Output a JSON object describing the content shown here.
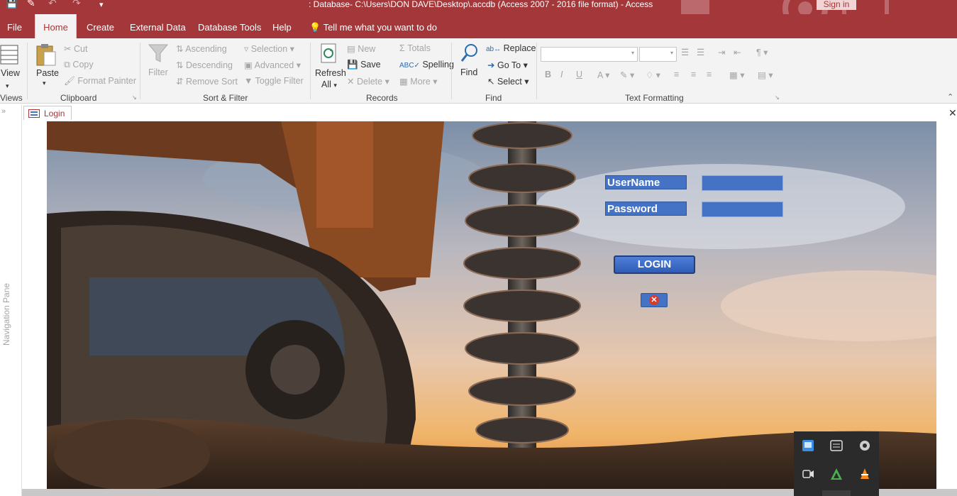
{
  "window": {
    "title": ": Database- C:\\Users\\DON DAVE\\Desktop\\.accdb (Access 2007 - 2016 file format)  -  Access",
    "sign_in": "Sign in",
    "quick_access": [
      "save-icon",
      "form-view-icon",
      "undo-icon",
      "redo-icon",
      "customize-icon"
    ]
  },
  "menu": {
    "tabs": [
      "File",
      "Home",
      "Create",
      "External Data",
      "Database Tools",
      "Help"
    ],
    "active": "Home",
    "tell_me": "Tell me what you want to do"
  },
  "ribbon": {
    "views": {
      "view": "View",
      "group": "Views"
    },
    "clipboard": {
      "paste": "Paste",
      "cut": "Cut",
      "copy": "Copy",
      "format_painter": "Format Painter",
      "group": "Clipboard"
    },
    "sort_filter": {
      "filter": "Filter",
      "ascending": "Ascending",
      "descending": "Descending",
      "remove_sort": "Remove Sort",
      "selection": "Selection",
      "advanced": "Advanced",
      "toggle_filter": "Toggle Filter",
      "group": "Sort & Filter"
    },
    "records": {
      "refresh": "Refresh",
      "refresh_all": "All",
      "new": "New",
      "save": "Save",
      "delete": "Delete",
      "totals": "Totals",
      "spelling": "Spelling",
      "more": "More",
      "group": "Records"
    },
    "find": {
      "find": "Find",
      "replace": "Replace",
      "goto": "Go To",
      "select": "Select",
      "group": "Find"
    },
    "text_formatting": {
      "group": "Text Formatting",
      "bold": "B",
      "italic": "I",
      "underline": "U"
    }
  },
  "navigation": {
    "pane_label": "Navigation Pane"
  },
  "document": {
    "tab": "Login"
  },
  "login_form": {
    "username_label": "UserName",
    "password_label": "Password",
    "username_value": "",
    "password_value": "",
    "login_button": "LOGIN",
    "cancel_icon": "close-circle-icon"
  },
  "tray": {
    "icons": [
      "network-icon",
      "settings-icon",
      "sync-icon",
      "camera-icon",
      "triangle-app-icon",
      "vlc-icon"
    ]
  },
  "colors": {
    "accent": "#a4373a",
    "form_blue": "#4472c4",
    "ribbon_bg": "#f3f3f3"
  }
}
